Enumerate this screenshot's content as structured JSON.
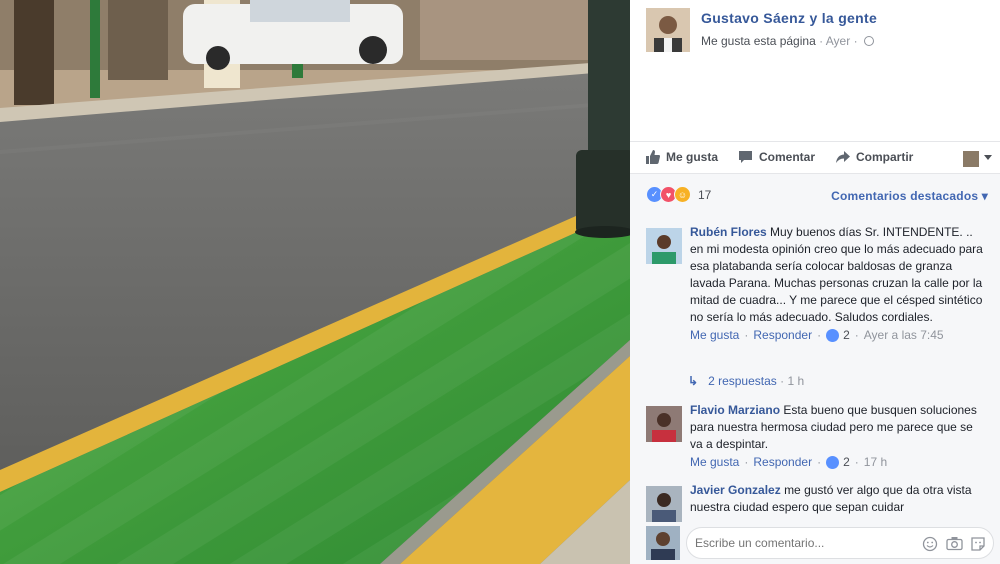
{
  "post": {
    "page_name": "Gustavo Sáenz y la gente",
    "like_page": "Me gusta esta página",
    "sep": "·",
    "time": "Ayer",
    "privacy_icon": "globe-icon"
  },
  "actions": {
    "like": "Me gusta",
    "comment": "Comentar",
    "share": "Compartir"
  },
  "reactions": {
    "count": "17",
    "types": [
      "like",
      "love",
      "haha"
    ],
    "sort_label": "Comentarios destacados"
  },
  "comments": [
    {
      "author": "Rubén Flores",
      "text": "Muy buenos días Sr. INTENDENTE. .. en mi modesta opinión creo que lo más adecuado para esa platabanda sería colocar baldosas de granza lavada Parana. Muchas personas cruzan la calle por la mitad de cuadra... Y me parece que el césped sintético no sería lo más adecuado. Saludos cordiales.",
      "like": "Me gusta",
      "reply": "Responder",
      "likes": "2",
      "time": "Ayer a las 7:45",
      "replies": "2 respuestas",
      "replies_time": "1 h"
    },
    {
      "author": "Flavio Marziano",
      "text": "Esta bueno que busquen soluciones para nuestra hermosa ciudad pero me parece que se va a despintar.",
      "like": "Me gusta",
      "reply": "Responder",
      "likes": "2",
      "time": "17 h"
    },
    {
      "author": "Javier Gonzalez",
      "text": "me gustó ver algo que da otra vista nuestra ciudad espero que sepan cuidar"
    }
  ],
  "composer": {
    "placeholder": "Escribe un comentario..."
  },
  "colors": {
    "link": "#365899",
    "accent": "#4267b2",
    "turf": "#3f9a3a",
    "curb": "#e2b33a",
    "asphalt": "#6b6b69"
  }
}
